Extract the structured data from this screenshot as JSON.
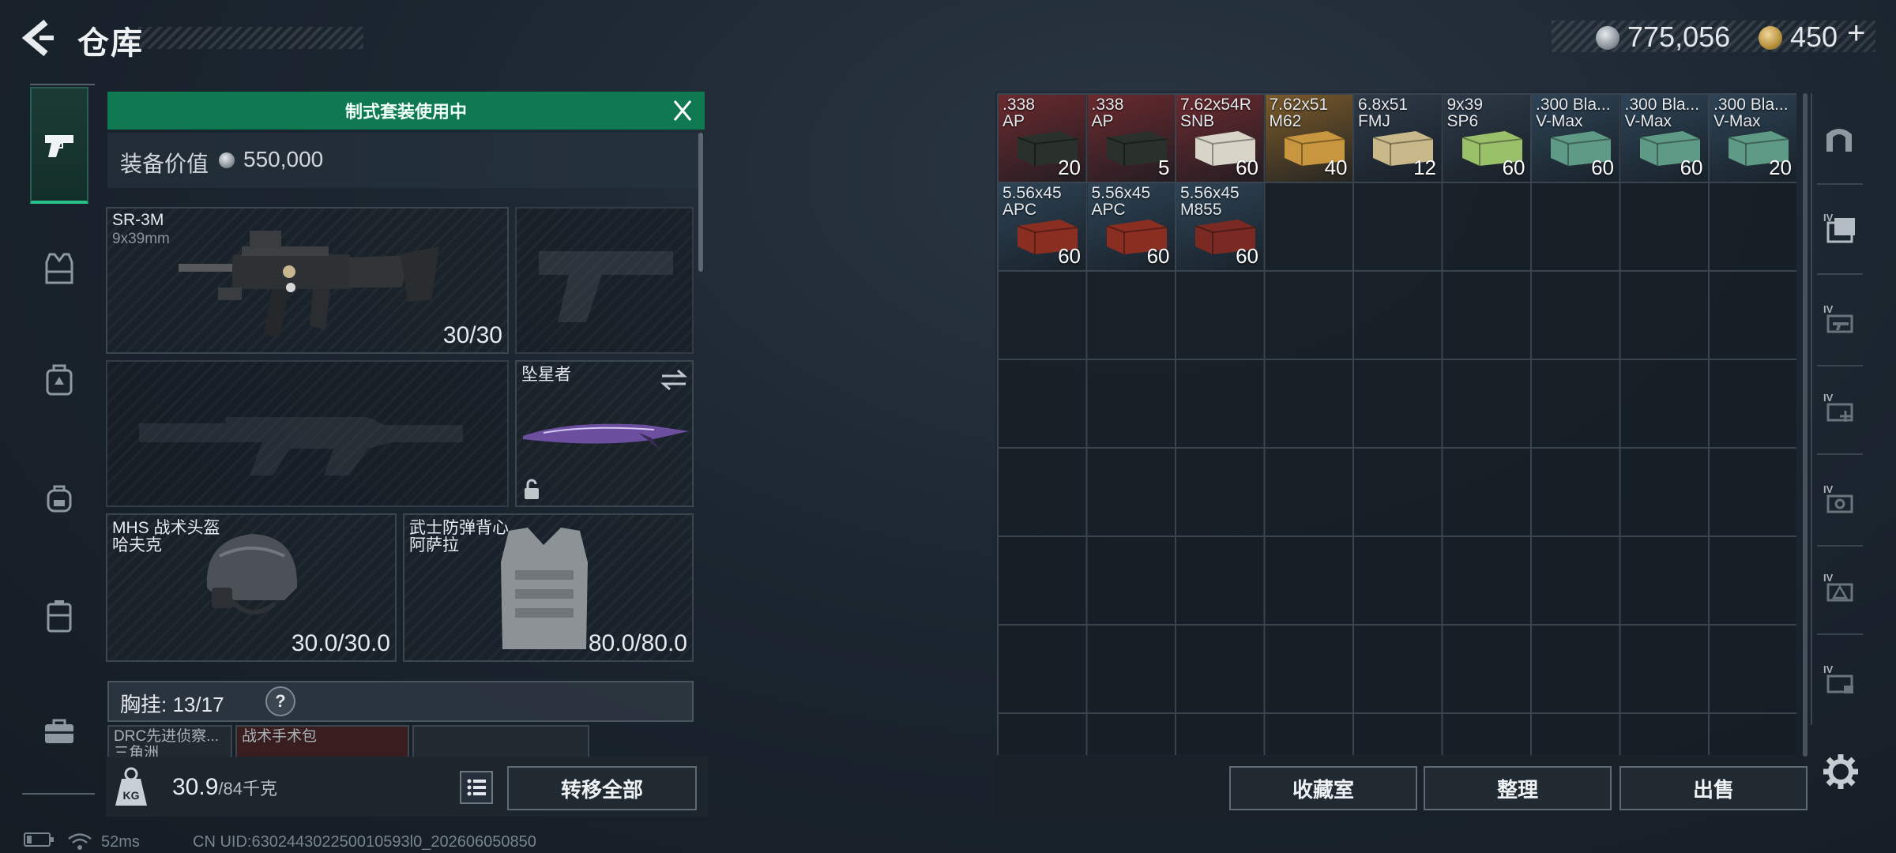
{
  "header": {
    "title": "仓库",
    "currency_primary": "775,056",
    "currency_secondary": "450",
    "currency_add": "+"
  },
  "left_nav": [
    {
      "name": "weapon",
      "icon": "pistol-icon",
      "active": true
    },
    {
      "name": "armor",
      "icon": "vest-icon",
      "active": false
    },
    {
      "name": "rig",
      "icon": "chest-rig-icon",
      "active": false
    },
    {
      "name": "backpack",
      "icon": "backpack-icon",
      "active": false
    },
    {
      "name": "case",
      "icon": "container-icon",
      "active": false
    },
    {
      "name": "toolbox",
      "icon": "toolbox-icon",
      "active": false
    }
  ],
  "loadout": {
    "banner": "制式套装使用中",
    "value_label": "装备价值",
    "value": "550,000",
    "primary_weapon": {
      "name": "SR-3M",
      "caliber": "9x39mm",
      "ammo": "30/30"
    },
    "melee": {
      "name": "坠星者"
    },
    "helmet": {
      "line1": "MHS 战术头盔",
      "line2": "哈夫克",
      "durability": "30.0/30.0"
    },
    "armor": {
      "line1": "武士防弹背心",
      "line2": "阿萨拉",
      "durability": "80.0/80.0"
    },
    "chest_rig": {
      "label": "胸挂:",
      "capacity": "13/17",
      "help": "?"
    },
    "pouches": [
      {
        "line1": "DRC先进侦察...",
        "line2": "三角洲"
      },
      {
        "line1": "战术手术包",
        "line2": ""
      }
    ],
    "weight": "30.9",
    "weight_max": "/84千克",
    "weight_icon_label": "KG",
    "transfer_all": "转移全部"
  },
  "storage": {
    "items": [
      {
        "name1": ".338",
        "name2": "AP",
        "count": "20",
        "bg": "#6b2a2e",
        "box": "#2a312c"
      },
      {
        "name1": ".338",
        "name2": "AP",
        "count": "5",
        "bg": "#6b2a2e",
        "box": "#2a312c"
      },
      {
        "name1": "7.62x54R",
        "name2": "SNB",
        "count": "60",
        "bg": "#6b2a2e",
        "box": "#d8d4c8"
      },
      {
        "name1": "7.62x51",
        "name2": "M62",
        "count": "40",
        "bg": "#7a5a2a",
        "box": "#c8963e"
      },
      {
        "name1": "6.8x51",
        "name2": "FMJ",
        "count": "12",
        "bg": "#2e3a48",
        "box": "#c9b88a"
      },
      {
        "name1": "9x39",
        "name2": "SP6",
        "count": "60",
        "bg": "#2e3a48",
        "box": "#9bc06a"
      },
      {
        "name1": ".300 Bla...",
        "name2": "V-Max",
        "count": "60",
        "bg": "#2e4456",
        "box": "#5f9a86"
      },
      {
        "name1": ".300 Bla...",
        "name2": "V-Max",
        "count": "60",
        "bg": "#2e4456",
        "box": "#5f9a86"
      },
      {
        "name1": ".300 Bla...",
        "name2": "V-Max",
        "count": "20",
        "bg": "#2e4456",
        "box": "#5f9a86"
      },
      {
        "name1": "5.56x45",
        "name2": "APC",
        "count": "60",
        "bg": "#2e4456",
        "box": "#8a2e22"
      },
      {
        "name1": "5.56x45",
        "name2": "APC",
        "count": "60",
        "bg": "#2e4456",
        "box": "#8a2e22"
      },
      {
        "name1": "5.56x45",
        "name2": "M855",
        "count": "60",
        "bg": "#2e4456",
        "box": "#7a2a22"
      }
    ],
    "btn_collection": "收藏室",
    "btn_sort": "整理",
    "btn_sell": "出售"
  },
  "right_nav": [
    {
      "name": "arch",
      "icon": "arch-icon"
    },
    {
      "name": "storage-1",
      "icon": "crate-icon",
      "label": "IV"
    },
    {
      "name": "storage-2",
      "icon": "crate-gun-icon",
      "label": "IV"
    },
    {
      "name": "storage-3",
      "icon": "crate-medical-icon",
      "label": "IV"
    },
    {
      "name": "storage-4",
      "icon": "crate-gear-icon",
      "label": "IV"
    },
    {
      "name": "storage-5",
      "icon": "crate-warning-icon",
      "label": "IV"
    },
    {
      "name": "storage-6",
      "icon": "crate-misc-icon",
      "label": "IV"
    }
  ],
  "status": {
    "ping": "52ms",
    "uid": "CN UID:630244302250010593l0_202606050850"
  }
}
